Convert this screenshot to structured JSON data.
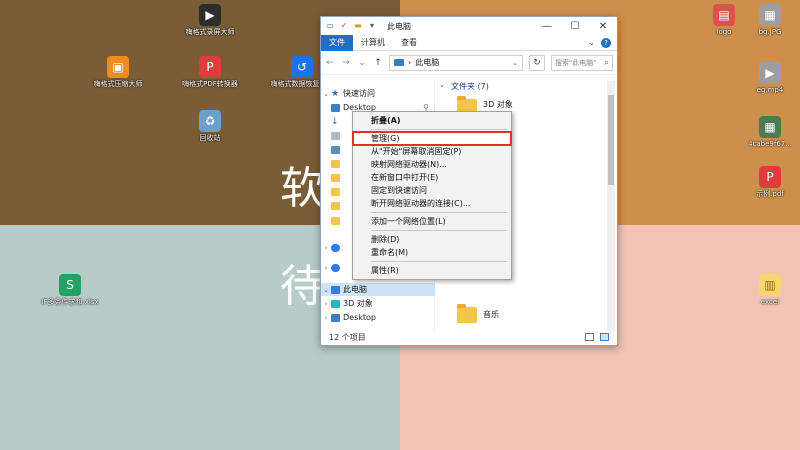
{
  "desktop": {
    "big_chars": [
      "软",
      "待"
    ],
    "icons": [
      {
        "label": "嗨格式录屏大师",
        "icon": "video-icon",
        "color": "#2d2d2d"
      },
      {
        "label": "嗨格式压缩大师",
        "icon": "compress-icon",
        "color": "#f28b1e"
      },
      {
        "label": "嗨格式PDF转换器",
        "icon": "pdf-icon",
        "color": "#e23b3b"
      },
      {
        "label": "嗨格式数据恢复大师",
        "icon": "recovery-icon",
        "color": "#1a73e8"
      },
      {
        "label": "回收站",
        "icon": "recycle-bin-icon",
        "color": "#6aa0c9"
      },
      {
        "label": "IF多条件求和.xlsx",
        "icon": "excel-icon",
        "color": "#21a366"
      },
      {
        "label": "logo",
        "icon": "image-file-icon",
        "color": "#d9534f"
      },
      {
        "label": "bg.JPG",
        "icon": "image-file-icon",
        "color": "#9e9e9e"
      },
      {
        "label": "eg.mp4",
        "icon": "video-file-icon",
        "color": "#9e9e9e"
      },
      {
        "label": "4cabe9f67...",
        "icon": "image-file-icon",
        "color": "#4e7a52"
      },
      {
        "label": "示例.pdf",
        "icon": "pdf-file-icon",
        "color": "#e23b3b"
      },
      {
        "label": "excel",
        "icon": "archive-icon",
        "color": "#f5d76e"
      }
    ]
  },
  "explorer": {
    "title": "此电脑",
    "ribbon_tabs": [
      "文件",
      "计算机",
      "查看"
    ],
    "address": "此电脑",
    "search_placeholder": "搜索\"此电脑\"",
    "nav": [
      {
        "label": "快速访问",
        "icon": "star-icon",
        "color": "#1e6fc5"
      },
      {
        "label": "Desktop",
        "icon": "desktop-icon",
        "color": "#3a7bd5"
      },
      {
        "label": "此电脑",
        "icon": "pc-icon",
        "color": "#3a7bd5"
      },
      {
        "label": "3D 对象",
        "icon": "cube-icon",
        "color": "#2bb3c0"
      },
      {
        "label": "Desktop",
        "icon": "desktop-icon",
        "color": "#3a7bd5"
      }
    ],
    "content": {
      "group_header": "文件夹 (7)",
      "items": [
        "3D 对象",
        "音乐"
      ]
    },
    "status": "12 个项目"
  },
  "context_menu": {
    "items": [
      "折叠(A)",
      "管理(G)",
      "从\"开始\"屏幕取消固定(P)",
      "映射网络驱动器(N)...",
      "在新窗口中打开(E)",
      "固定到快速访问",
      "断开网络驱动器的连接(C)...",
      "添加一个网络位置(L)",
      "删除(D)",
      "重命名(M)",
      "属性(R)"
    ]
  }
}
